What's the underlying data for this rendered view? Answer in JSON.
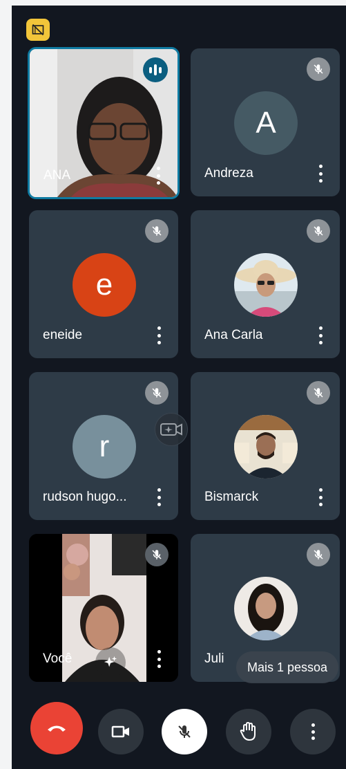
{
  "participants": [
    {
      "name": "ANA",
      "type": "video",
      "speaking": true
    },
    {
      "name": "Andreza",
      "type": "initial",
      "initial": "A",
      "color": "#455a64",
      "muted": true
    },
    {
      "name": "eneide",
      "type": "initial",
      "initial": "e",
      "color": "#d84315",
      "muted": true
    },
    {
      "name": "Ana Carla",
      "type": "photo",
      "muted": true
    },
    {
      "name": "rudson hugo...",
      "type": "initial",
      "initial": "r",
      "color": "#78909c",
      "muted": true
    },
    {
      "name": "Bismarck",
      "type": "photo",
      "muted": true
    },
    {
      "name": "Você",
      "type": "video",
      "muted": true
    },
    {
      "name": "Juli",
      "type": "photo",
      "muted": true
    }
  ],
  "more_people_label": "Mais 1 pessoa",
  "colors": {
    "background": "#121720",
    "tile": "#2e3b47",
    "active_border": "#0f7ba2",
    "end_call": "#ea4335",
    "badge": "#f2c53a"
  },
  "controls": [
    "end-call",
    "camera",
    "microphone",
    "raise-hand",
    "more-options"
  ]
}
